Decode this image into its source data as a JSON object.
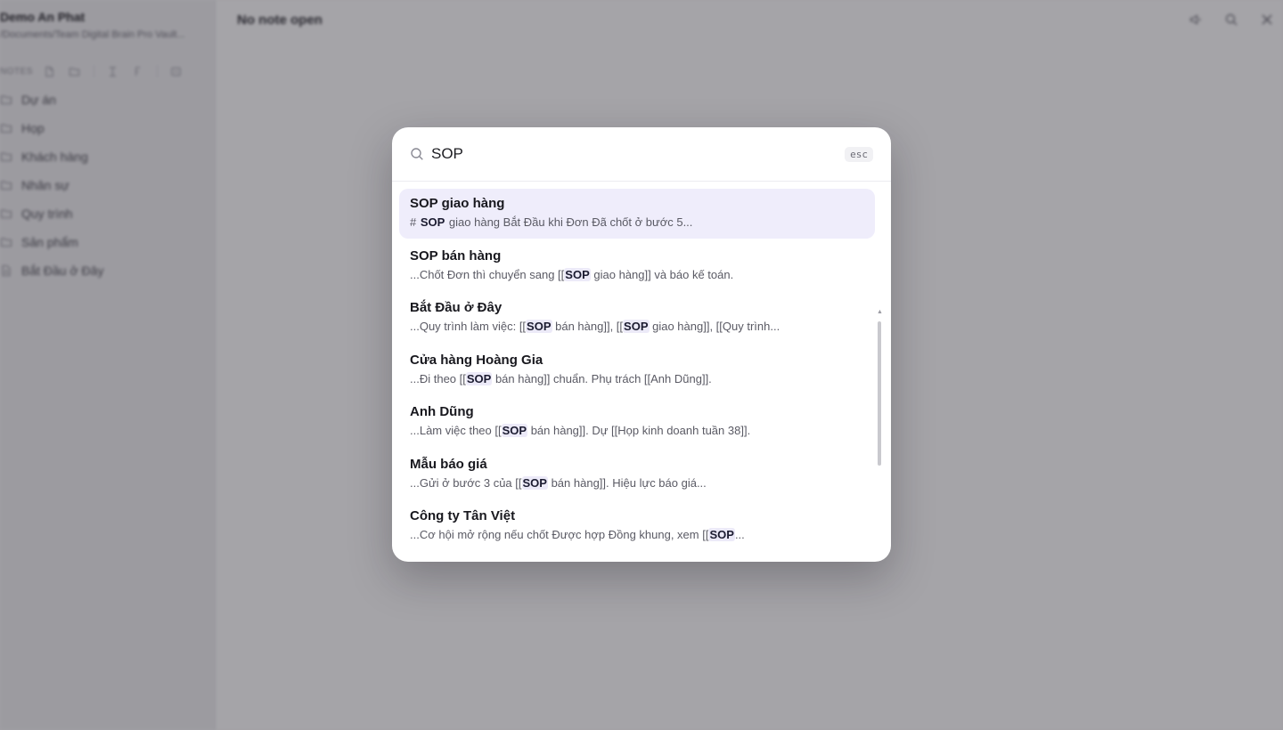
{
  "sidebar": {
    "vault_name": "Demo An Phat",
    "vault_path": "/Documents/Team Digital Brain Pro Vault...",
    "notes_label": "NOTES",
    "items": [
      {
        "label": "Dự án",
        "type": "folder"
      },
      {
        "label": "Họp",
        "type": "folder"
      },
      {
        "label": "Khách hàng",
        "type": "folder"
      },
      {
        "label": "Nhân sự",
        "type": "folder"
      },
      {
        "label": "Quy trình",
        "type": "folder"
      },
      {
        "label": "Sản phẩm",
        "type": "folder"
      },
      {
        "label": "Bắt Đầu ở Đây",
        "type": "file"
      }
    ]
  },
  "main": {
    "title": "No note open"
  },
  "search": {
    "query": "SOP",
    "esc_label": "esc",
    "results": [
      {
        "title": "SOP giao hàng",
        "snippet_pre": "# ",
        "snippet_mid": " giao hàng Bắt Đầu khi Đơn Đã chốt ở bước 5...",
        "active": true
      },
      {
        "title": "SOP bán hàng",
        "snippet_pre": "...Chốt Đơn thì chuyển sang [[",
        "snippet_mid": " giao hàng]] và báo kế toán."
      },
      {
        "title": "Bắt Đầu ở Đây",
        "snippet_pre": "...Quy trình làm việc: [[",
        "snippet_mid": " bán hàng]], [[",
        "snippet_post": " giao hàng]], [[Quy trình..."
      },
      {
        "title": "Cửa hàng Hoàng Gia",
        "snippet_pre": "...Đi theo [[",
        "snippet_mid": " bán hàng]] chuẩn. Phụ trách [[Anh Dũng]]."
      },
      {
        "title": "Anh Dũng",
        "snippet_pre": "...Làm việc theo [[",
        "snippet_mid": " bán hàng]]. Dự [[Họp kinh doanh tuần 38]]."
      },
      {
        "title": "Mẫu báo giá",
        "snippet_pre": "...Gửi ở bước 3 của [[",
        "snippet_mid": " bán hàng]]. Hiệu lực báo giá..."
      },
      {
        "title": "Công ty Tân Việt",
        "snippet_pre": "...Cơ hội mở rộng nếu chốt Được hợp Đồng khung, xem [[",
        "snippet_mid": "..."
      }
    ]
  }
}
